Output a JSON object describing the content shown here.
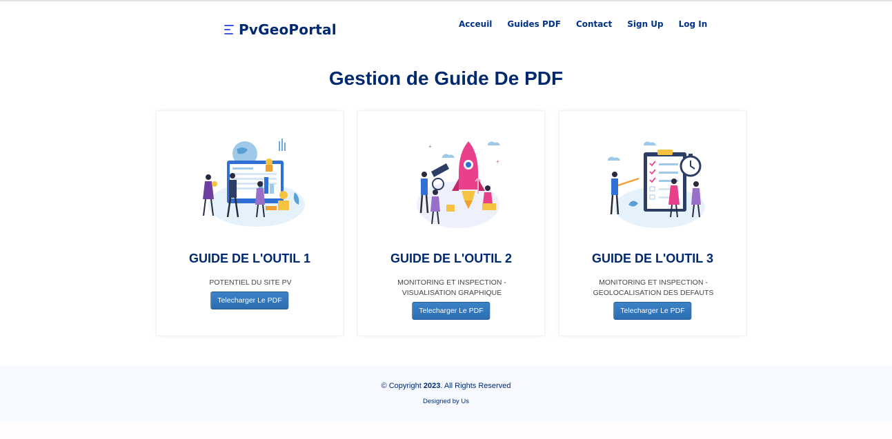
{
  "brand": {
    "name": "PvGeoPortal"
  },
  "nav": [
    {
      "label": "Acceuil"
    },
    {
      "label": "Guides PDF"
    },
    {
      "label": "Contact"
    },
    {
      "label": "Sign Up"
    },
    {
      "label": "Log In"
    }
  ],
  "page": {
    "title": "Gestion de Guide De PDF"
  },
  "cards": [
    {
      "title": "GUIDE DE L'OUTIL 1",
      "description": "POTENTIEL DU SITE PV",
      "button": "Telecharger Le PDF",
      "illustration": "analytics-illustration"
    },
    {
      "title": "GUIDE DE L'OUTIL 2",
      "description": "MONITORING ET INSPECTION - VISUALISATION GRAPHIQUE",
      "button": "Telecharger Le PDF",
      "illustration": "rocket-illustration"
    },
    {
      "title": "GUIDE DE L'OUTIL 3",
      "description": "MONITORING ET INSPECTION - GEOLOCALISATION DES DEFAUTS",
      "button": "Telecharger Le PDF",
      "illustration": "checklist-illustration"
    }
  ],
  "footer": {
    "copyright_prefix": "© Copyright",
    "year": "2023",
    "copyright_suffix": ". All Rights Reserved",
    "credits": "Designed by Us"
  },
  "colors": {
    "brand": "#012970",
    "button": "#337ab7",
    "footer_bg": "#f6f9ff",
    "accent": "#4154f1"
  }
}
